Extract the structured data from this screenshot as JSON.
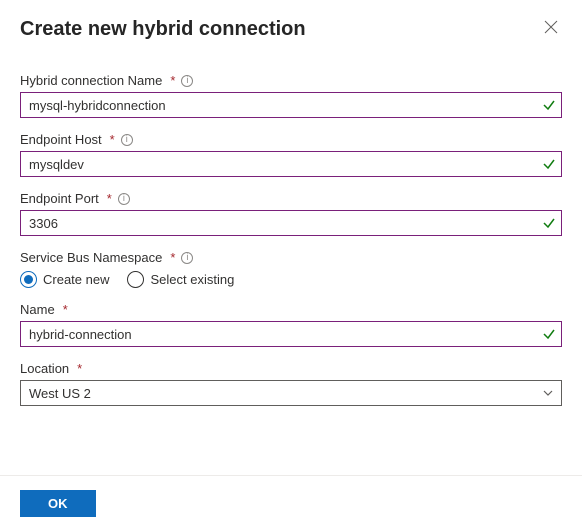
{
  "header": {
    "title": "Create new hybrid connection"
  },
  "fields": {
    "hcn": {
      "label": "Hybrid connection Name",
      "value": "mysql-hybridconnection"
    },
    "host": {
      "label": "Endpoint Host",
      "value": "mysqldev"
    },
    "port": {
      "label": "Endpoint Port",
      "value": "3306"
    },
    "sbn": {
      "label": "Service Bus Namespace"
    },
    "name": {
      "label": "Name",
      "value": "hybrid-connection"
    },
    "location": {
      "label": "Location",
      "value": "West US 2"
    }
  },
  "radios": {
    "create_new": "Create new",
    "select_existing": "Select existing"
  },
  "buttons": {
    "ok": "OK"
  }
}
